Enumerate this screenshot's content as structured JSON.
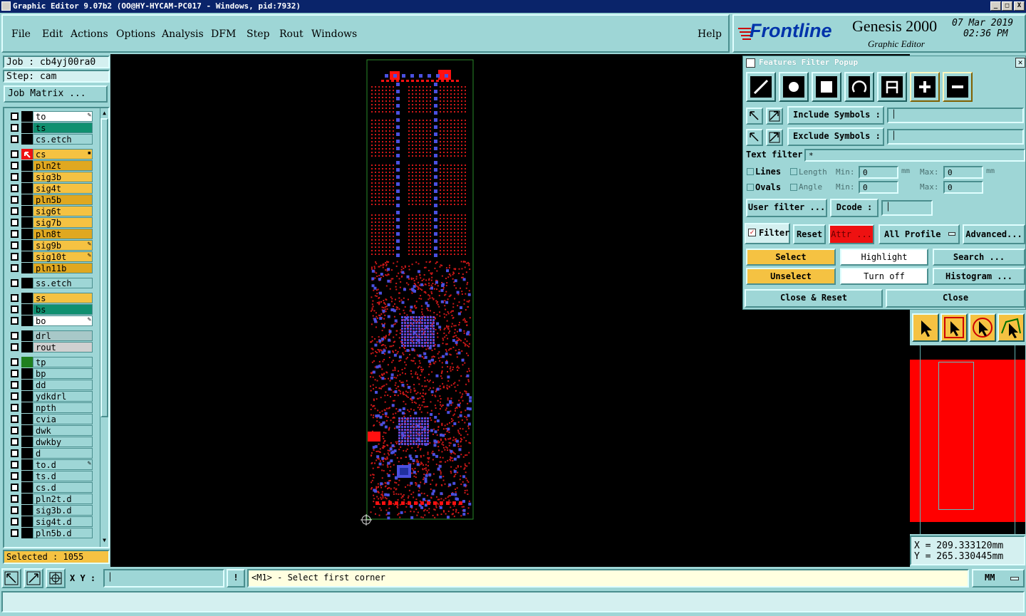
{
  "window": {
    "title": "Graphic Editor 9.07b2 (OO@HY-HYCAM-PC017 - Windows, pid:7932)",
    "buttons": [
      "_",
      "□",
      "X"
    ]
  },
  "menu": {
    "items": [
      "File",
      "Edit",
      "Actions",
      "Options",
      "Analysis",
      "DFM",
      "Step",
      "Rout",
      "Windows"
    ],
    "help": "Help"
  },
  "brand": {
    "logo": "Frontline",
    "product": "Genesis 2000",
    "subtitle": "Graphic Editor",
    "date": "07 Mar 2019",
    "time": "02:36 PM",
    "logo_color": "#cc0000"
  },
  "job": {
    "job_label": "Job : cb4yj00ra0",
    "step_label": "Step: cam",
    "matrix_button": "Job Matrix ..."
  },
  "layers": [
    {
      "name": "to",
      "color": "#ffffff",
      "mark": "true"
    },
    {
      "name": "ts",
      "color": "#109070"
    },
    {
      "name": "cs.etch",
      "color": "#9ed6d6"
    },
    {
      "name": "cs",
      "color": "#f5c242",
      "active": "true"
    },
    {
      "name": "pln2t",
      "color": "#e0a820"
    },
    {
      "name": "sig3b",
      "color": "#f5c242"
    },
    {
      "name": "sig4t",
      "color": "#f5c242"
    },
    {
      "name": "pln5b",
      "color": "#e0a820"
    },
    {
      "name": "sig6t",
      "color": "#f5c242"
    },
    {
      "name": "sig7b",
      "color": "#f5c242"
    },
    {
      "name": "pln8t",
      "color": "#e0a820"
    },
    {
      "name": "sig9b",
      "color": "#f5c242",
      "mark": "true"
    },
    {
      "name": "sig10t",
      "color": "#f5c242",
      "mark": "true"
    },
    {
      "name": "pln11b",
      "color": "#e0a820"
    },
    {
      "name": "ss.etch",
      "color": "#9ed6d6"
    },
    {
      "name": "ss",
      "color": "#f5c242"
    },
    {
      "name": "bs",
      "color": "#109070"
    },
    {
      "name": "bo",
      "color": "#ffffff",
      "mark": "true"
    },
    {
      "name": "drl",
      "color": "#a8c8c8"
    },
    {
      "name": "rout",
      "color": "#d0d0d0"
    },
    {
      "name": "tp",
      "color": "#9ed6d6",
      "swatch": "#208020"
    },
    {
      "name": "bp",
      "color": "#9ed6d6"
    },
    {
      "name": "dd",
      "color": "#9ed6d6"
    },
    {
      "name": "ydkdrl",
      "color": "#9ed6d6"
    },
    {
      "name": "npth",
      "color": "#9ed6d6"
    },
    {
      "name": "cvia",
      "color": "#9ed6d6"
    },
    {
      "name": "dwk",
      "color": "#9ed6d6"
    },
    {
      "name": "dwkby",
      "color": "#9ed6d6"
    },
    {
      "name": "d",
      "color": "#9ed6d6"
    },
    {
      "name": "to.d",
      "color": "#9ed6d6",
      "mark": "true"
    },
    {
      "name": "ts.d",
      "color": "#9ed6d6"
    },
    {
      "name": "cs.d",
      "color": "#9ed6d6"
    },
    {
      "name": "pln2t.d",
      "color": "#9ed6d6"
    },
    {
      "name": "sig3b.d",
      "color": "#9ed6d6"
    },
    {
      "name": "sig4t.d",
      "color": "#9ed6d6"
    },
    {
      "name": "pln5b.d",
      "color": "#9ed6d6"
    }
  ],
  "selected": "Selected : 1055",
  "filter_popup": {
    "title": "Features Filter Popup",
    "include_symbols": "Include Symbols :",
    "exclude_symbols": "Exclude Symbols :",
    "text_filter_label": "Text filter",
    "text_filter_value": "*",
    "lines": "Lines",
    "ovals": "Ovals",
    "length": "Length",
    "angle": "Angle",
    "min": "Min:",
    "max": "Max:",
    "unit": "mm",
    "length_min": "0",
    "length_max": "0",
    "angle_min": "0",
    "angle_max": "0",
    "user_filter": "User filter ...",
    "dcode": "Dcode :",
    "filter": "Filter",
    "reset": "Reset",
    "attr": "Attr ...",
    "all_profile": "All Profile",
    "advanced": "Advanced...",
    "select": "Select",
    "highlight": "Highlight",
    "search": "Search ...",
    "unselect": "Unselect",
    "turn_off": "Turn off",
    "histogram": "Histogram ...",
    "close_reset": "Close & Reset",
    "close": "Close"
  },
  "coords": {
    "x": "X = 209.333120mm",
    "y": "Y = 265.330445mm"
  },
  "bottom": {
    "xy_label": "X Y :",
    "prompt": "<M1> - Select first corner",
    "unit": "MM",
    "excl": "!"
  }
}
